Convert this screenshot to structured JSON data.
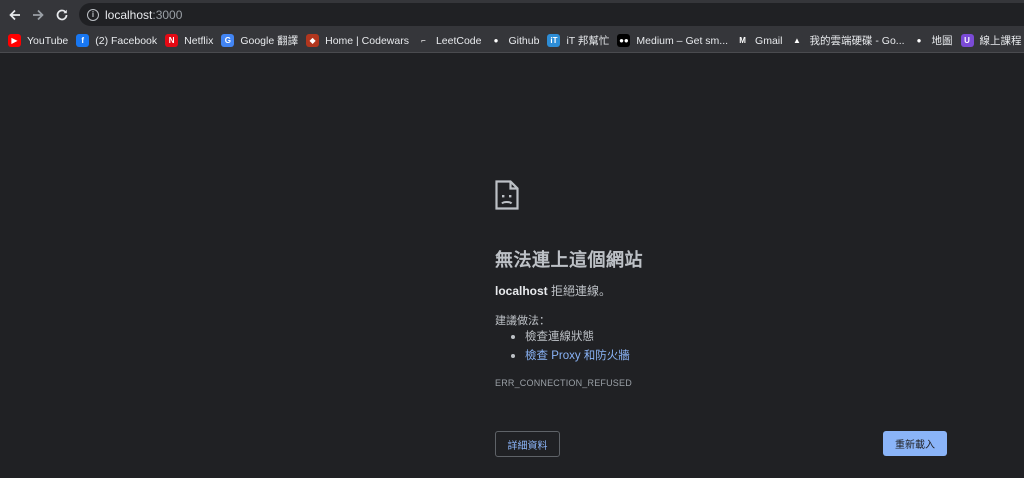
{
  "toolbar": {
    "url_host": "localhost",
    "url_port": ":3000"
  },
  "bookmarks": [
    {
      "label": "YouTube",
      "icon": "youtube-icon",
      "color": "#ff0000",
      "glyph": "▶"
    },
    {
      "label": "(2) Facebook",
      "icon": "facebook-icon",
      "color": "#1877f2",
      "glyph": "f"
    },
    {
      "label": "Netflix",
      "icon": "netflix-icon",
      "color": "#e50914",
      "glyph": "N"
    },
    {
      "label": "Google 翻譯",
      "icon": "google-translate-icon",
      "color": "#4285f4",
      "glyph": "G"
    },
    {
      "label": "Home | Codewars",
      "icon": "codewars-icon",
      "color": "#b1361e",
      "glyph": "◆"
    },
    {
      "label": "LeetCode",
      "icon": "leetcode-icon",
      "color": "#35363a",
      "glyph": "⌐"
    },
    {
      "label": "Github",
      "icon": "github-icon",
      "color": "#35363a",
      "glyph": "●"
    },
    {
      "label": "iT 邦幫忙",
      "icon": "ithome-icon",
      "color": "#2d8dd6",
      "glyph": "iT"
    },
    {
      "label": "Medium – Get sm...",
      "icon": "medium-icon",
      "color": "#000000",
      "glyph": "●●"
    },
    {
      "label": "Gmail",
      "icon": "gmail-icon",
      "color": "#35363a",
      "glyph": "M"
    },
    {
      "label": "我的雲端硬碟 - Go...",
      "icon": "google-drive-icon",
      "color": "#35363a",
      "glyph": "▲"
    },
    {
      "label": "地圖",
      "icon": "google-maps-icon",
      "color": "#35363a",
      "glyph": "●"
    },
    {
      "label": "線上課程 - 隨時隨",
      "icon": "course-icon",
      "color": "#7b4bd6",
      "glyph": "U"
    }
  ],
  "error_page": {
    "title": "無法連上這個網站",
    "host": "localhost",
    "message": " 拒絕連線。",
    "suggest_label": "建議做法：",
    "suggestions": [
      {
        "label": "檢查連線狀態",
        "link": false
      },
      {
        "label": "檢查 Proxy 和防火牆",
        "link": true
      }
    ],
    "error_code": "ERR_CONNECTION_REFUSED",
    "details_label": "詳細資料",
    "reload_label": "重新載入"
  }
}
